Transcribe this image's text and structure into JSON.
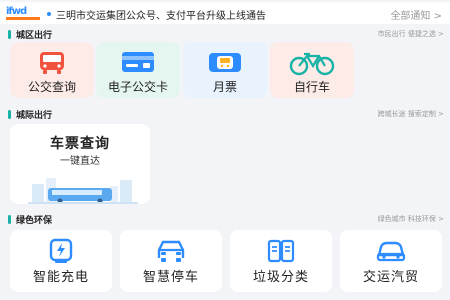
{
  "notice": {
    "logo_text": "ifwd",
    "message": "三明市交运集团公众号、支付平台升级上线通告",
    "more": "全部通知 >"
  },
  "sections": {
    "city": {
      "title": "城区出行",
      "subtitle": "市民出行 便捷之选 >"
    },
    "intercity": {
      "title": "城际出行",
      "subtitle": "跨城长途 搜索定制 >"
    },
    "green": {
      "title": "绿色环保",
      "subtitle": "绿色城市 科技环保 >"
    }
  },
  "city_items": [
    {
      "label": "公交查询",
      "icon": "bus-icon",
      "bg": "#fdebe8"
    },
    {
      "label": "电子公交卡",
      "icon": "card-icon",
      "bg": "#e5f6f0"
    },
    {
      "label": "月票",
      "icon": "ticket-bus-icon",
      "bg": "#e9f3fd"
    },
    {
      "label": "自行车",
      "icon": "bicycle-icon",
      "bg": "#fdebe8"
    }
  ],
  "intercity": {
    "title": "车票查询",
    "subtitle": "一键直达"
  },
  "green_items": [
    {
      "label": "智能充电",
      "icon": "charging-icon"
    },
    {
      "label": "智慧停车",
      "icon": "parking-icon"
    },
    {
      "label": "垃圾分类",
      "icon": "trash-sort-icon"
    },
    {
      "label": "交运汽贸",
      "icon": "car-trade-icon"
    }
  ],
  "colors": {
    "accent": "#19b2a6",
    "icon_blue": "#2d8cff",
    "icon_red": "#f0533e",
    "icon_green": "#2ab77d",
    "icon_teal": "#19b2a6"
  }
}
